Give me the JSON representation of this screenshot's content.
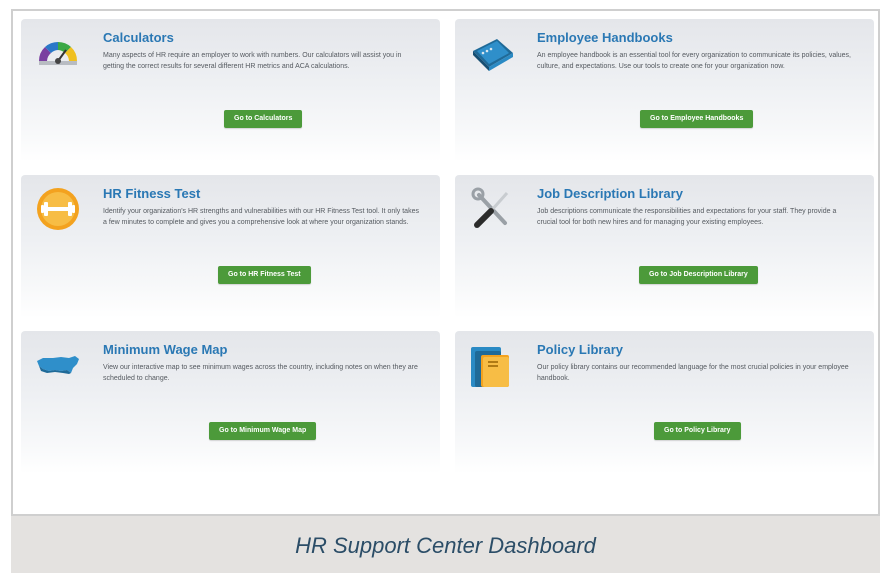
{
  "caption": "HR Support Center Dashboard",
  "colors": {
    "title": "#2a78b4",
    "button": "#4c9a3a",
    "caption": "#2b4d67"
  },
  "cards": [
    {
      "icon": "speedometer-gauge-icon",
      "title": "Calculators",
      "description": "Many aspects of HR require an employer to work with numbers. Our calculators will assist you in getting the correct results for several different HR metrics and ACA calculations.",
      "button": "Go to Calculators"
    },
    {
      "icon": "handbook-binder-icon",
      "title": "Employee Handbooks",
      "description": "An employee handbook is an essential tool for every organization to communicate its policies, values, culture, and expectations. Use our tools to create one for your organization now.",
      "button": "Go to Employee Handbooks"
    },
    {
      "icon": "dumbbell-fitness-icon",
      "title": "HR Fitness Test",
      "description": "Identify your organization's HR strengths and vulnerabilities with our HR Fitness Test tool. It only takes a few minutes to complete and gives you a comprehensive look at where your organization stands.",
      "button": "Go to HR Fitness Test"
    },
    {
      "icon": "wrench-screwdriver-icon",
      "title": "Job Description Library",
      "description": "Job descriptions communicate the responsibilities and expectations for your staff. They provide a crucial tool for both new hires and for managing your existing employees.",
      "button": "Go to Job Description Library"
    },
    {
      "icon": "us-map-icon",
      "title": "Minimum Wage Map",
      "description": "View our interactive map to see minimum wages across the country, including notes on when they are scheduled to change.",
      "button": "Go to Minimum Wage Map"
    },
    {
      "icon": "policy-folders-icon",
      "title": "Policy Library",
      "description": "Our policy library contains our recommended language for the most crucial policies in your employee handbook.",
      "button": "Go to Policy Library"
    }
  ]
}
